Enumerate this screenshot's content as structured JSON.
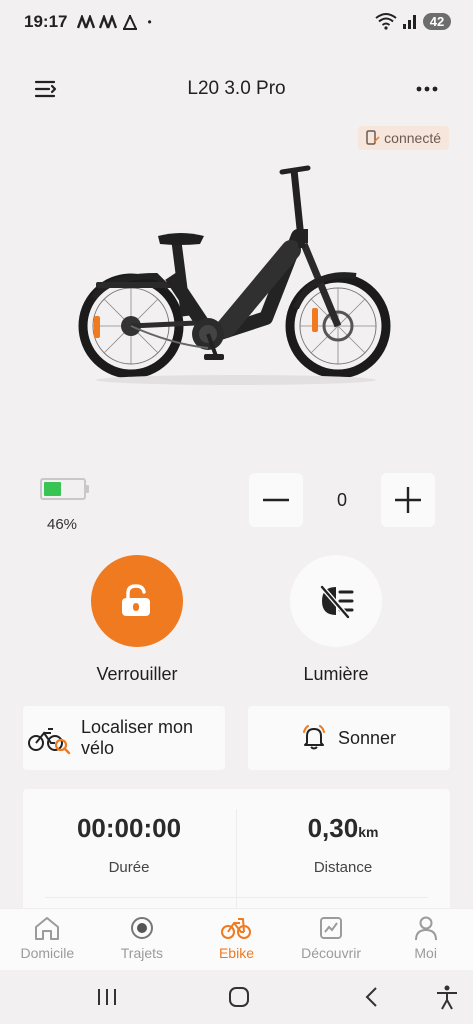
{
  "status_bar": {
    "time": "19:17",
    "battery": "42"
  },
  "header": {
    "title": "L20 3.0 Pro"
  },
  "connection": {
    "label": "connecté"
  },
  "battery": {
    "percent_label": "46%",
    "level": 0.46
  },
  "assist_level": {
    "value": "0"
  },
  "actions": {
    "lock_label": "Verrouiller",
    "light_label": "Lumière",
    "locate_label": "Localiser mon vélo",
    "ring_label": "Sonner"
  },
  "stats": {
    "duration_value": "00:00:00",
    "duration_label": "Durée",
    "distance_value": "0,30",
    "distance_unit": "km",
    "distance_label": "Distance"
  },
  "tabs": [
    {
      "label": "Domicile",
      "icon": "home-icon"
    },
    {
      "label": "Trajets",
      "icon": "target-icon"
    },
    {
      "label": "Ebike",
      "icon": "bike-icon"
    },
    {
      "label": "Découvrir",
      "icon": "chart-icon"
    },
    {
      "label": "Moi",
      "icon": "user-icon"
    }
  ],
  "colors": {
    "accent": "#f07a20",
    "battery": "#38c452"
  }
}
